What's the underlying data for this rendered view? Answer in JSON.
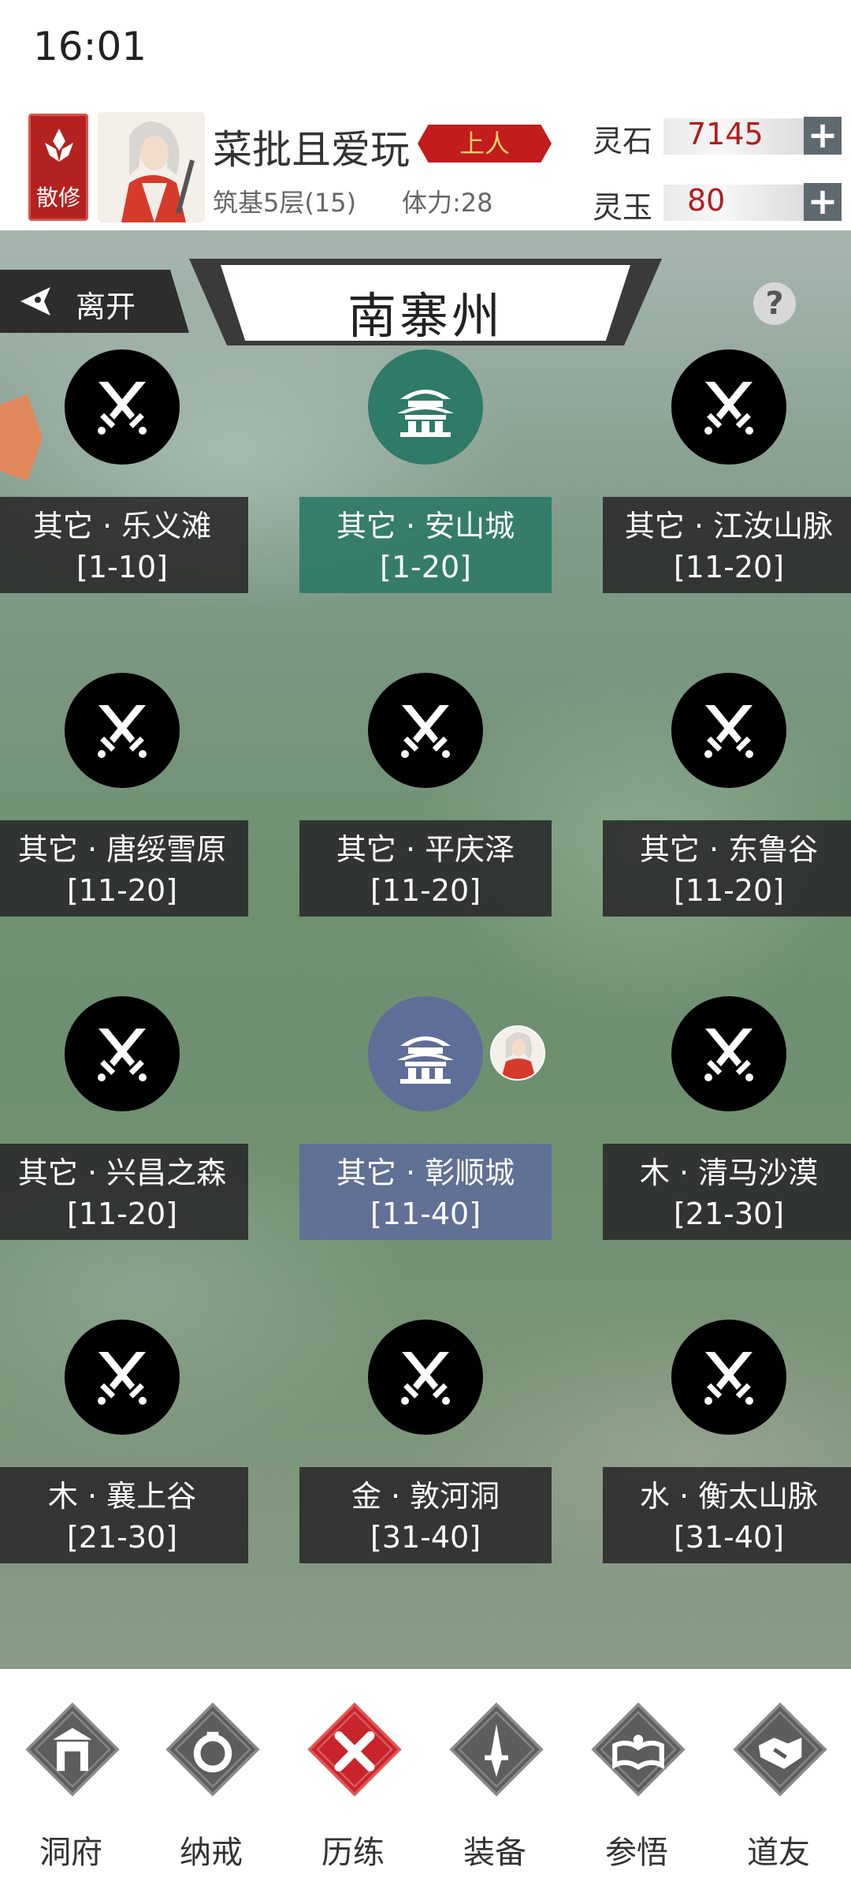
{
  "status_bar": {
    "time": "16:01"
  },
  "header": {
    "sect_label": "散修",
    "player_name": "菜批且爱玩",
    "rank": "上人",
    "realm": "筑基5层(15)",
    "stamina": "体力:28",
    "resources": [
      {
        "label": "灵石",
        "value": "7145"
      },
      {
        "label": "灵玉",
        "value": "80"
      }
    ]
  },
  "map": {
    "leave_label": "离开",
    "region_name": "南寨州",
    "help_icon": "?",
    "nodes": [
      {
        "name": "其它 · 乐义滩",
        "range": "[1-10]",
        "type": "combat"
      },
      {
        "name": "其它 · 安山城",
        "range": "[1-20]",
        "type": "city"
      },
      {
        "name": "其它 · 江汝山脉",
        "range": "[11-20]",
        "type": "combat"
      },
      {
        "name": "其它 · 唐绥雪原",
        "range": "[11-20]",
        "type": "combat"
      },
      {
        "name": "其它 · 平庆泽",
        "range": "[11-20]",
        "type": "combat"
      },
      {
        "name": "其它 · 东鲁谷",
        "range": "[11-20]",
        "type": "combat"
      },
      {
        "name": "其它 · 兴昌之森",
        "range": "[11-20]",
        "type": "combat"
      },
      {
        "name": "其它 · 彰顺城",
        "range": "[11-40]",
        "type": "city-current"
      },
      {
        "name": "木 · 清马沙漠",
        "range": "[21-30]",
        "type": "combat"
      },
      {
        "name": "木 · 襄上谷",
        "range": "[21-30]",
        "type": "combat"
      },
      {
        "name": "金 · 敦河洞",
        "range": "[31-40]",
        "type": "combat"
      },
      {
        "name": "水 · 衡太山脉",
        "range": "[31-40]",
        "type": "combat"
      }
    ]
  },
  "bottom_nav": [
    {
      "label": "洞府",
      "icon": "cave-dwelling-icon"
    },
    {
      "label": "纳戒",
      "icon": "storage-ring-icon"
    },
    {
      "label": "历练",
      "icon": "crossed-swords-icon",
      "active": true
    },
    {
      "label": "装备",
      "icon": "sword-icon"
    },
    {
      "label": "参悟",
      "icon": "book-icon"
    },
    {
      "label": "道友",
      "icon": "handshake-icon"
    }
  ],
  "colors": {
    "accent_red": "#c21c1c",
    "city_green": "#2f7a68",
    "city_blue": "#5f6e98",
    "node_dark": "#000000"
  }
}
